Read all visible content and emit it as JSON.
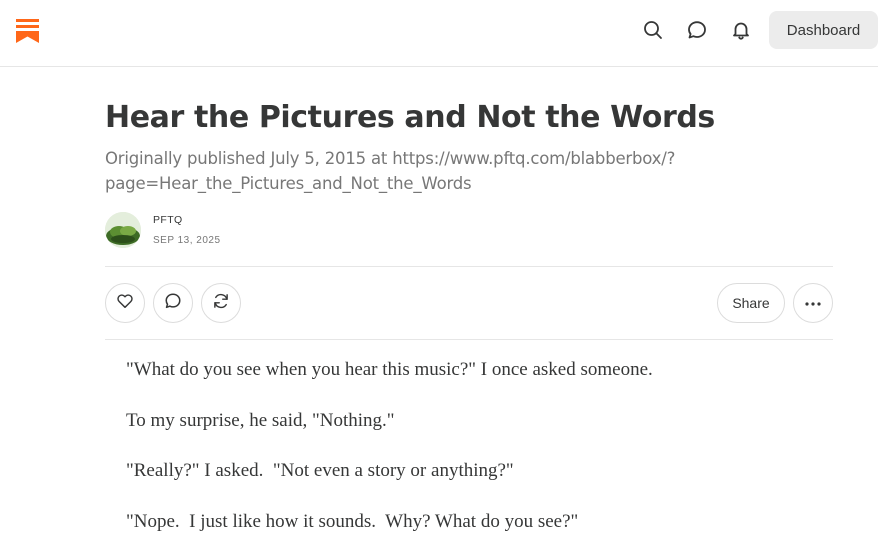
{
  "topbar": {
    "logo_icon": "substack-logo-icon",
    "brand_color": "#ff6719",
    "icons": [
      "search-icon",
      "chat-icon",
      "bell-icon"
    ],
    "dashboard_label": "Dashboard"
  },
  "article": {
    "title": "Hear the Pictures and Not the Words",
    "subtitle_line1": "Originally published July 5, 2015 at https://www.pftq.com/blabberbox/?",
    "subtitle_line2": "page=Hear_the_Pictures_and_Not_the_Words",
    "author": "PFTQ",
    "date": "SEP 13, 2025"
  },
  "actions": {
    "icons": [
      "heart-icon",
      "comment-icon",
      "restack-icon",
      "more-icon"
    ],
    "share_label": "Share"
  },
  "body": {
    "paragraphs": [
      "\"What do you see when you hear this music?\" I once asked someone.",
      "To my surprise, he said, \"Nothing.\"",
      "\"Really?\" I asked.  \"Not even a story or anything?\"",
      "\"Nope.  I just like how it sounds.  Why? What do you see?\""
    ]
  }
}
